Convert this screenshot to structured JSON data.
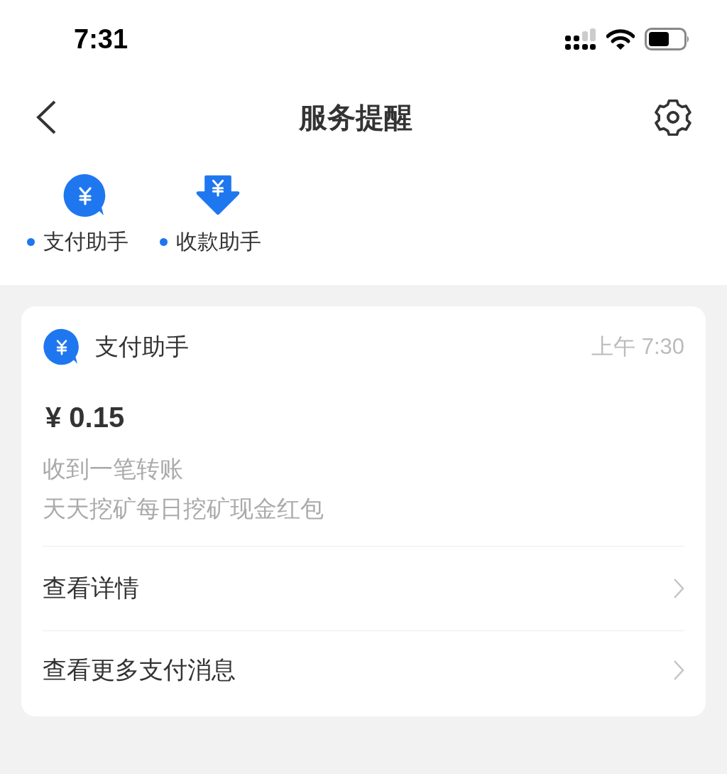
{
  "status_bar": {
    "time": "7:31"
  },
  "header": {
    "title": "服务提醒"
  },
  "assistants": [
    {
      "kind": "bubble",
      "label": "支付助手",
      "unread": true
    },
    {
      "kind": "arrow",
      "label": "收款助手",
      "unread": true
    }
  ],
  "message": {
    "kind": "bubble",
    "sender": "支付助手",
    "time": "上午 7:30",
    "amount": "¥ 0.15",
    "lines": [
      "收到一笔转账",
      "天天挖矿每日挖矿现金红包"
    ],
    "links": [
      "查看详情",
      "查看更多支付消息"
    ]
  }
}
